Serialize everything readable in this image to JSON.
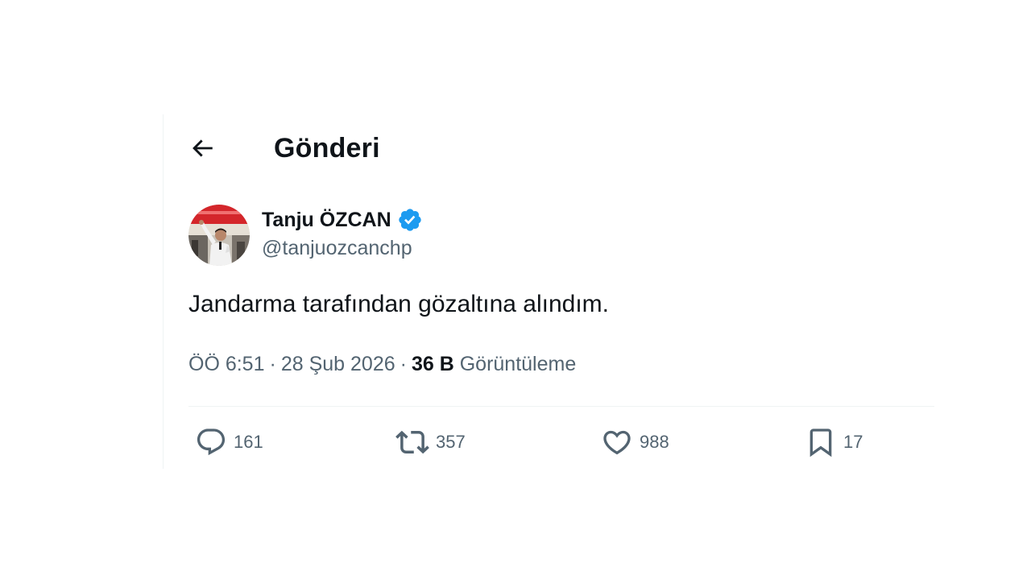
{
  "header": {
    "back_icon": "arrow-left-icon",
    "title": "Gönderi"
  },
  "author": {
    "avatar_icon": "avatar",
    "display_name": "Tanju ÖZCAN",
    "verified_icon": "verified-badge-icon",
    "verified_color": "#1d9bf0",
    "handle": "@tanjuozcanchp"
  },
  "tweet": {
    "text": "Jandarma tarafından gözaltına alındım.",
    "time": "ÖÖ 6:51",
    "date": "28 Şub 2026",
    "separator": "·",
    "views_count": "36 B",
    "views_label": "Görüntüleme"
  },
  "actions": {
    "reply": {
      "icon": "reply-icon",
      "count": "161"
    },
    "repost": {
      "icon": "repost-icon",
      "count": "357"
    },
    "like": {
      "icon": "heart-icon",
      "count": "988"
    },
    "bookmark": {
      "icon": "bookmark-icon",
      "count": "17"
    }
  },
  "colors": {
    "text_primary": "#0f1419",
    "text_secondary": "#536471",
    "border": "#eff3f4",
    "accent": "#1d9bf0"
  }
}
